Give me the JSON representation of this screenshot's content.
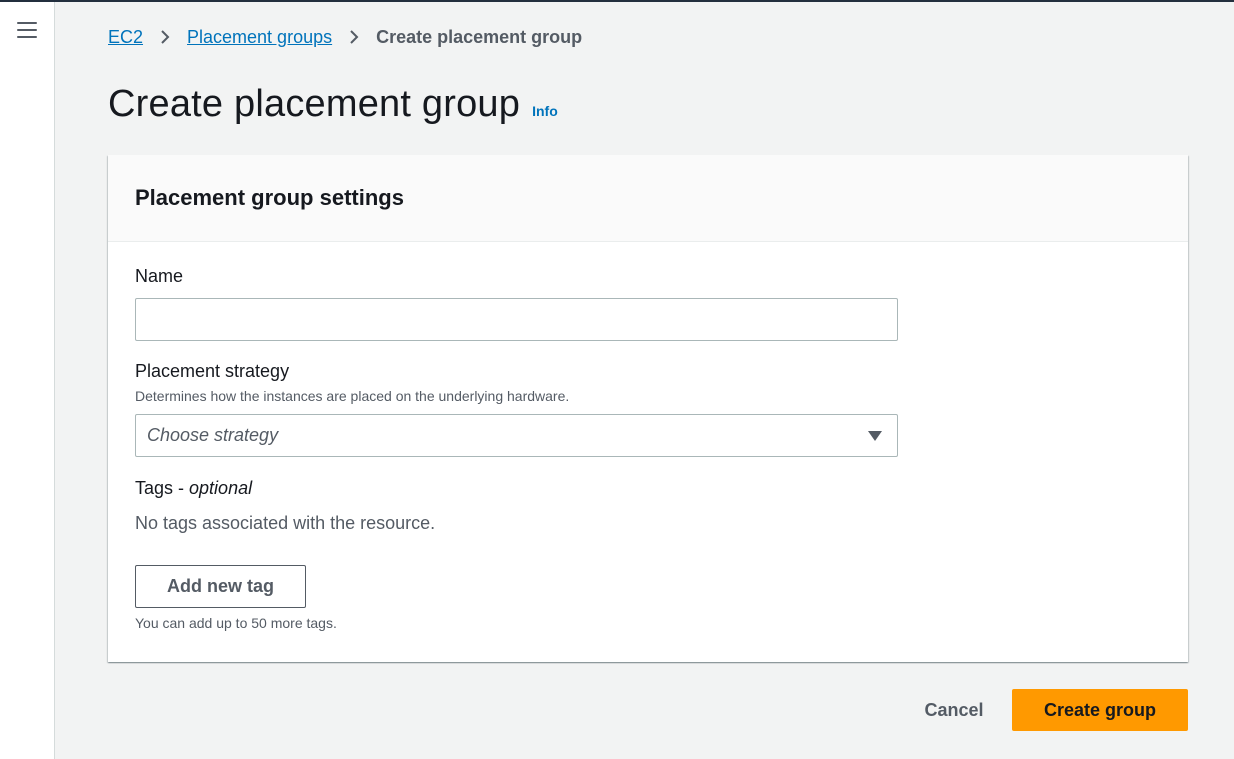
{
  "breadcrumb": {
    "items": [
      "EC2",
      "Placement groups"
    ],
    "current": "Create placement group"
  },
  "page": {
    "title": "Create placement group",
    "info_link": "Info"
  },
  "panel": {
    "title": "Placement group settings",
    "name": {
      "label": "Name",
      "value": ""
    },
    "strategy": {
      "label": "Placement strategy",
      "description": "Determines how the instances are placed on the underlying hardware.",
      "placeholder": "Choose strategy"
    },
    "tags": {
      "label": "Tags - ",
      "label_optional": "optional",
      "empty_text": "No tags associated with the resource.",
      "add_button": "Add new tag",
      "limit_text": "You can add up to 50 more tags."
    }
  },
  "actions": {
    "cancel": "Cancel",
    "submit": "Create group"
  },
  "colors": {
    "link": "#0073bb",
    "primary_button": "#ff9900",
    "top_bar": "#232f3e"
  },
  "icons": [
    "menu-icon",
    "chevron-right-icon",
    "caret-down-icon"
  ]
}
